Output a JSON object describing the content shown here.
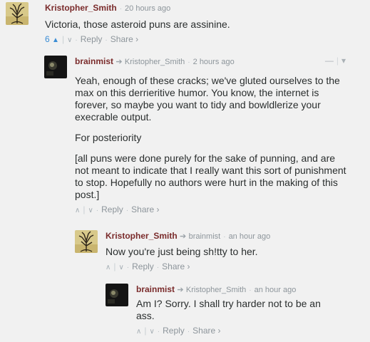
{
  "comments": [
    {
      "author": "Kristopher_Smith",
      "reply_to": "",
      "time": "20 hours ago",
      "paragraphs": [
        "Victoria, those asteroid puns are assinine."
      ],
      "votes": "6",
      "reply_label": "Reply",
      "share_label": "Share ›",
      "avatar_icon": "tree-avatar-icon"
    },
    {
      "author": "brainmist",
      "reply_to": "Kristopher_Smith",
      "time": "2 hours ago",
      "paragraphs": [
        "Yeah, enough of these cracks; we've gluted ourselves to the max on this derrieritive humor. You know, the internet is forever, so maybe you want to tidy and bowldlerize your execrable output.",
        "For posteriority",
        "[all puns were done purely for the sake of punning, and are not meant to indicate that I really want this sort of punishment to stop. Hopefully no authors were hurt in the making of this post.]"
      ],
      "votes": "",
      "reply_label": "Reply",
      "share_label": "Share ›",
      "avatar_icon": "dark-avatar-icon"
    },
    {
      "author": "Kristopher_Smith",
      "reply_to": "brainmist",
      "time": "an hour ago",
      "paragraphs": [
        "Now you're just being sh!tty to her."
      ],
      "votes": "",
      "reply_label": "Reply",
      "share_label": "Share ›",
      "avatar_icon": "tree-avatar-icon"
    },
    {
      "author": "brainmist",
      "reply_to": "Kristopher_Smith",
      "time": "an hour ago",
      "paragraphs": [
        "Am I? Sorry. I shall try harder not to be an ass."
      ],
      "votes": "",
      "reply_label": "Reply",
      "share_label": "Share ›",
      "avatar_icon": "dark-avatar-icon"
    }
  ],
  "controls": {
    "collapse_label": "—",
    "menu_label": "▾"
  },
  "colors": {
    "author": "#7a2b2b",
    "vote_accent": "#3b8dd5",
    "meta": "#8d959b",
    "background": "#f1f1f1"
  }
}
